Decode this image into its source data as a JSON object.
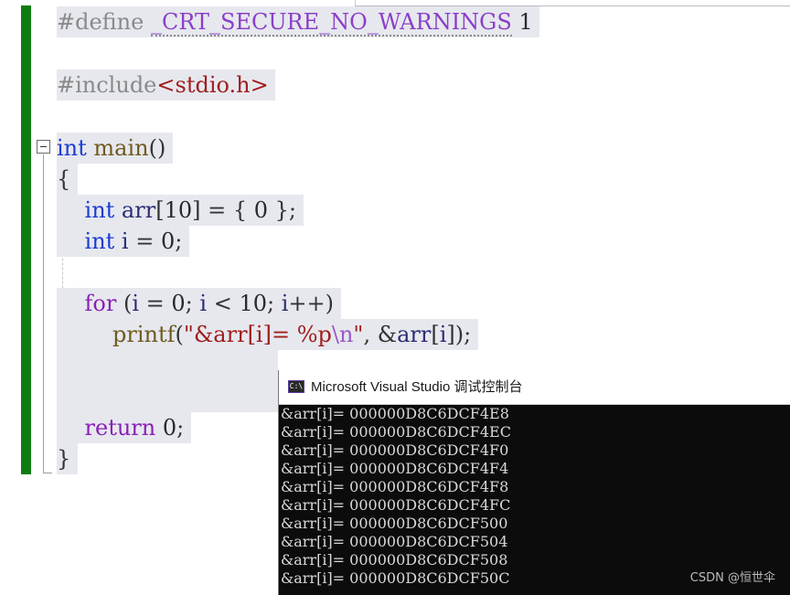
{
  "editor": {
    "lines": {
      "define": {
        "directive": "#define ",
        "macro": "_CRT_SECURE_NO_WARNINGS",
        "value": " 1"
      },
      "include": {
        "directive": "#include",
        "header": "<stdio.h>"
      },
      "main_sig": {
        "kw": "int",
        "sp": " ",
        "name": "main",
        "parens": "()"
      },
      "open_brace": "{",
      "arr_decl": {
        "kw": "int",
        "name": " arr",
        "rest1": "[",
        "num": "10",
        "rest2": "] = { ",
        "zero": "0",
        "rest3": " };"
      },
      "i_decl": {
        "kw": "int",
        "name": " i",
        "rest1": " = ",
        "zero": "0",
        "rest2": ";"
      },
      "for_line": {
        "kw": "for",
        "p1": " (",
        "v1": "i",
        "p2": " = ",
        "n1": "0",
        "p3": "; ",
        "v2": "i",
        "p4": " < ",
        "n2": "10",
        "p5": "; ",
        "v3": "i",
        "p6": "++)"
      },
      "printf_line": {
        "fn": "printf",
        "p1": "(",
        "str1": "\"&arr[i]= %p",
        "esc": "\\n",
        "str2": "\"",
        "p2": ", &",
        "arr": "arr",
        "p3": "[",
        "i": "i",
        "p4": "]);"
      },
      "return_line": {
        "kw": "return",
        "sp": " ",
        "num": "0",
        "semi": ";"
      },
      "close_brace": "}"
    }
  },
  "console": {
    "title": "Microsoft Visual Studio 调试控制台",
    "icon_label": "C:\\",
    "icon": "console-app-icon",
    "lines": [
      "&arr[i]= 000000D8C6DCF4E8",
      "&arr[i]= 000000D8C6DCF4EC",
      "&arr[i]= 000000D8C6DCF4F0",
      "&arr[i]= 000000D8C6DCF4F4",
      "&arr[i]= 000000D8C6DCF4F8",
      "&arr[i]= 000000D8C6DCF4FC",
      "&arr[i]= 000000D8C6DCF500",
      "&arr[i]= 000000D8C6DCF504",
      "&arr[i]= 000000D8C6DCF508",
      "&arr[i]= 000000D8C6DCF50C"
    ]
  },
  "watermark": "CSDN @恒世伞",
  "colors": {
    "change_bar": "#107c10",
    "keyword": "#1b3cd2",
    "macro": "#8b3fc8",
    "string": "#a01e1e",
    "function": "#6f5a1e",
    "console_bg": "#0c0c0c"
  }
}
